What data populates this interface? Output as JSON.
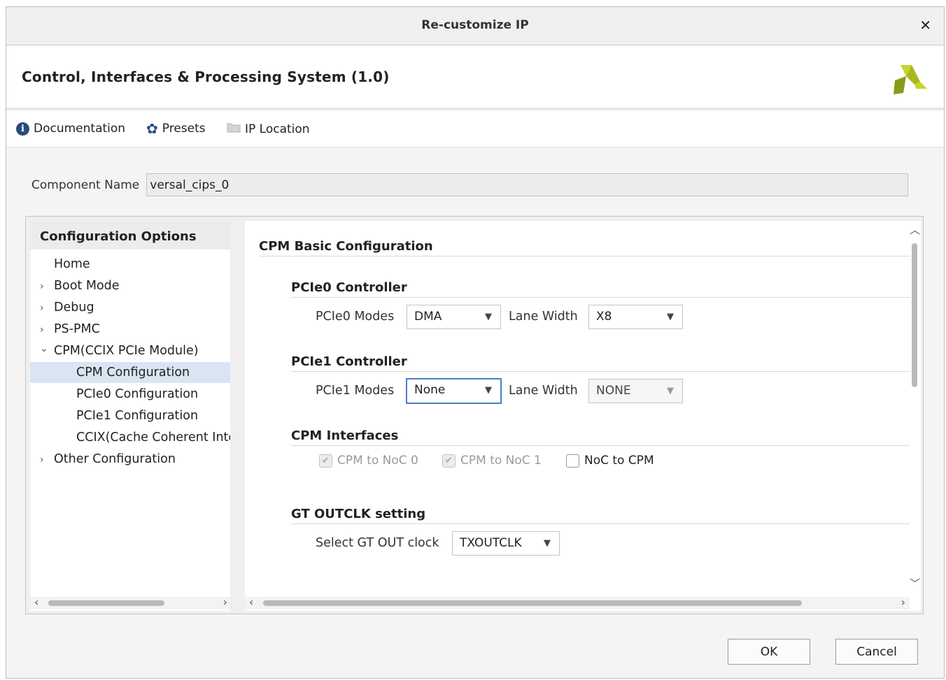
{
  "window": {
    "title": "Re-customize IP",
    "close_glyph": "✕"
  },
  "header": {
    "ip_title": "Control, Interfaces & Processing System (1.0)",
    "logo": "xilinx-logo"
  },
  "toolbar": {
    "documentation": "Documentation",
    "presets": "Presets",
    "ip_location": "IP Location"
  },
  "component": {
    "label": "Component Name",
    "value": "versal_cips_0"
  },
  "config_options": {
    "title": "Configuration Options",
    "items": [
      {
        "label": "Home",
        "arrow": ""
      },
      {
        "label": "Boot Mode",
        "arrow": "›"
      },
      {
        "label": "Debug",
        "arrow": "›"
      },
      {
        "label": "PS-PMC",
        "arrow": "›"
      },
      {
        "label": "CPM(CCIX PCIe Module)",
        "arrow": "⌄"
      },
      {
        "label": "CPM Configuration",
        "arrow": ""
      },
      {
        "label": "PCIe0 Configuration",
        "arrow": ""
      },
      {
        "label": "PCIe1 Configuration",
        "arrow": ""
      },
      {
        "label": "CCIX(Cache Coherent Interconnect)",
        "arrow": ""
      },
      {
        "label": "Other Configuration",
        "arrow": "›"
      }
    ],
    "selected": "CPM Configuration"
  },
  "cpm": {
    "title": "CPM Basic Configuration",
    "pcie0": {
      "title": "PCIe0 Controller",
      "modes_label": "PCIe0 Modes",
      "modes_value": "DMA",
      "lane_label": "Lane Width",
      "lane_value": "X8"
    },
    "pcie1": {
      "title": "PCIe1 Controller",
      "modes_label": "PCIe1 Modes",
      "modes_value": "None",
      "lane_label": "Lane Width",
      "lane_value": "NONE"
    },
    "interfaces": {
      "title": "CPM Interfaces",
      "cpm_to_noc0": {
        "label": "CPM to NoC 0",
        "checked": true,
        "enabled": false
      },
      "cpm_to_noc1": {
        "label": "CPM to NoC 1",
        "checked": true,
        "enabled": false
      },
      "noc_to_cpm": {
        "label": "NoC to CPM",
        "checked": false,
        "enabled": true
      }
    },
    "gt": {
      "title": "GT OUTCLK setting",
      "label": "Select GT OUT clock",
      "value": "TXOUTCLK"
    }
  },
  "buttons": {
    "ok": "OK",
    "cancel": "Cancel"
  },
  "colors": {
    "selection": "#d9e5f3",
    "focus": "#4a80c6",
    "logo_yellow": "#c8d42a",
    "logo_olive": "#8a9a1a"
  }
}
